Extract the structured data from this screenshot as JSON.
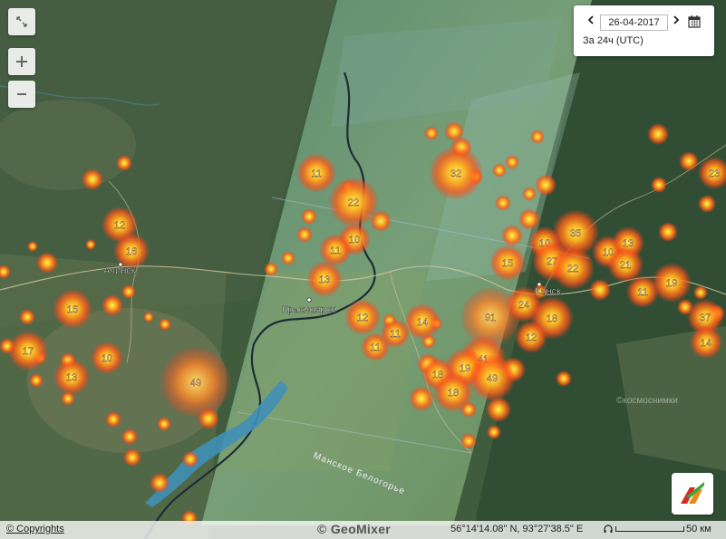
{
  "controls": {
    "fullscreen_icon": "fullscreen-icon",
    "zoom_in_icon": "plus-icon",
    "zoom_out_icon": "minus-icon"
  },
  "date_panel": {
    "date_value": "26-04-2017",
    "period_label": "За 24ч (UTC)",
    "prev_icon": "chevron-left-icon",
    "next_icon": "chevron-right-icon",
    "calendar_icon": "calendar-icon"
  },
  "map_labels": {
    "cities": [
      "Ачинск",
      "Красноярск",
      "Канск"
    ],
    "reservoir": "Манское Белогорье",
    "watermark": "©космоснимки"
  },
  "clusters": [
    "11",
    "22",
    "10",
    "11",
    "13",
    "12",
    "11",
    "11",
    "14",
    "32",
    "35",
    "15",
    "10",
    "27",
    "22",
    "10",
    "13",
    "21",
    "11",
    "19",
    "91",
    "24",
    "18",
    "12",
    "41",
    "19",
    "18",
    "49",
    "18",
    "12",
    "16",
    "15",
    "17",
    "10",
    "13",
    "49",
    "23",
    "37",
    "14"
  ],
  "footer": {
    "copyrights": "© Copyrights",
    "brand": "GeoMixer",
    "coordinates": "56°14'14.08\" N, 93°27'38.5\" E",
    "scale_label": "50 км",
    "scale_km": 50
  },
  "colors": {
    "hotspot_core": "#fff35a",
    "hotspot_mid": "#ff8a1a",
    "hotspot_outer": "#ff3a1a",
    "satellite_strip": "#6f9a6a",
    "terrain": "#3d5d3a"
  }
}
